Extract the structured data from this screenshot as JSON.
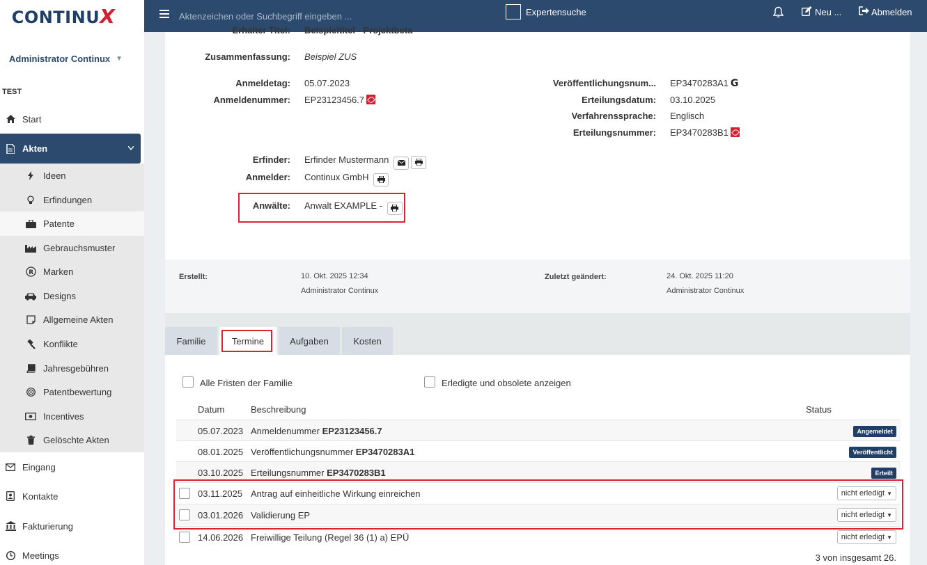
{
  "app": {
    "logo_text": "CONTINU",
    "logo_x": "X"
  },
  "user": {
    "name": "Administrator Continux",
    "org": "TEST"
  },
  "topbar": {
    "search_placeholder": "Aktenzeichen oder Suchbegriff eingeben ...",
    "expert_search": "Expertensuche",
    "new_label": "Neu ...",
    "logout_label": "Abmelden"
  },
  "nav": {
    "start": "Start",
    "akten": "Akten",
    "eingang": "Eingang",
    "kontakte": "Kontakte",
    "fakturierung": "Fakturierung",
    "meetings": "Meetings"
  },
  "submenu": [
    {
      "label": "Ideen",
      "icon": "bolt-icon"
    },
    {
      "label": "Erfindungen",
      "icon": "lightbulb-icon"
    },
    {
      "label": "Patente",
      "icon": "briefcase-icon"
    },
    {
      "label": "Gebrauchsmuster",
      "icon": "factory-icon"
    },
    {
      "label": "Marken",
      "icon": "registered-icon"
    },
    {
      "label": "Designs",
      "icon": "car-icon"
    },
    {
      "label": "Allgemeine Akten",
      "icon": "note-icon"
    },
    {
      "label": "Konflikte",
      "icon": "gavel-icon"
    },
    {
      "label": "Jahresgebühren",
      "icon": "book-icon"
    },
    {
      "label": "Patentbewertung",
      "icon": "target-icon"
    },
    {
      "label": "Incentives",
      "icon": "money-icon"
    },
    {
      "label": "Gelöschte Akten",
      "icon": "trash-icon"
    }
  ],
  "details": {
    "cut_label": "Erhalter Titel:",
    "cut_value": "Beispieltitel - Projektbeta",
    "summary_label": "Zusammenfassung:",
    "summary_value": "Beispiel ZUS",
    "filing_date_label": "Anmeldetag:",
    "filing_date_value": "05.07.2023",
    "application_no_label": "Anmeldenummer:",
    "application_no_value": "EP23123456.7",
    "publication_no_label": "Veröffentlichungsnum...",
    "publication_no_value": "EP3470283A1",
    "grant_date_label": "Erteilungsdatum:",
    "grant_date_value": "03.10.2025",
    "language_label": "Verfahrenssprache:",
    "language_value": "Englisch",
    "grant_no_label": "Erteilungsnummer:",
    "grant_no_value": "EP3470283B1",
    "inventor_label": "Erfinder:",
    "inventor_value": "Erfinder Mustermann",
    "applicant_label": "Anmelder:",
    "applicant_value": "Continux GmbH",
    "attorneys_label": "Anwälte:",
    "attorneys_value": "Anwalt EXAMPLE -"
  },
  "meta": {
    "created_label": "Erstellt:",
    "created_date": "10. Okt. 2025 12:34",
    "created_by": "Administrator Continux",
    "changed_label": "Zuletzt geändert:",
    "changed_date": "24. Okt. 2025 11:20",
    "changed_by": "Administrator Continux"
  },
  "tabs": [
    "Familie",
    "Termine",
    "Aufgaben",
    "Kosten"
  ],
  "deadlines": {
    "filter_family": "Alle Fristen der Familie",
    "filter_done": "Erledigte und obsolete anzeigen",
    "col_date": "Datum",
    "col_desc": "Beschreibung",
    "col_status": "Status",
    "rows": [
      {
        "date": "05.07.2023",
        "desc": "Anmeldenummer ",
        "desc_bold": "EP23123456.7",
        "status": "Angemeldet"
      },
      {
        "date": "08.01.2025",
        "desc": "Veröffentlichungsnummer ",
        "desc_bold": "EP3470283A1",
        "status": "Veröffentlicht"
      },
      {
        "date": "03.10.2025",
        "desc": "Erteilungsnummer ",
        "desc_bold": "EP3470283B1",
        "status": "Erteilt"
      },
      {
        "date": "03.11.2025",
        "desc": "Antrag auf einheitliche Wirkung einreichen",
        "desc_bold": "",
        "status": "nicht erledigt"
      },
      {
        "date": "03.01.2026",
        "desc": "Validierung EP",
        "desc_bold": "",
        "status": "nicht erledigt"
      },
      {
        "date": "14.06.2026",
        "desc": "Freiwillige Teilung (Regel 36 (1) a) EPÜ",
        "desc_bold": "",
        "status": "nicht erledigt"
      }
    ],
    "footer": "3 von insgesamt 26."
  },
  "colors": {
    "brand_navy": "#2c4a6e",
    "highlight_red": "#d9232e",
    "logo_red": "#d1202f"
  }
}
